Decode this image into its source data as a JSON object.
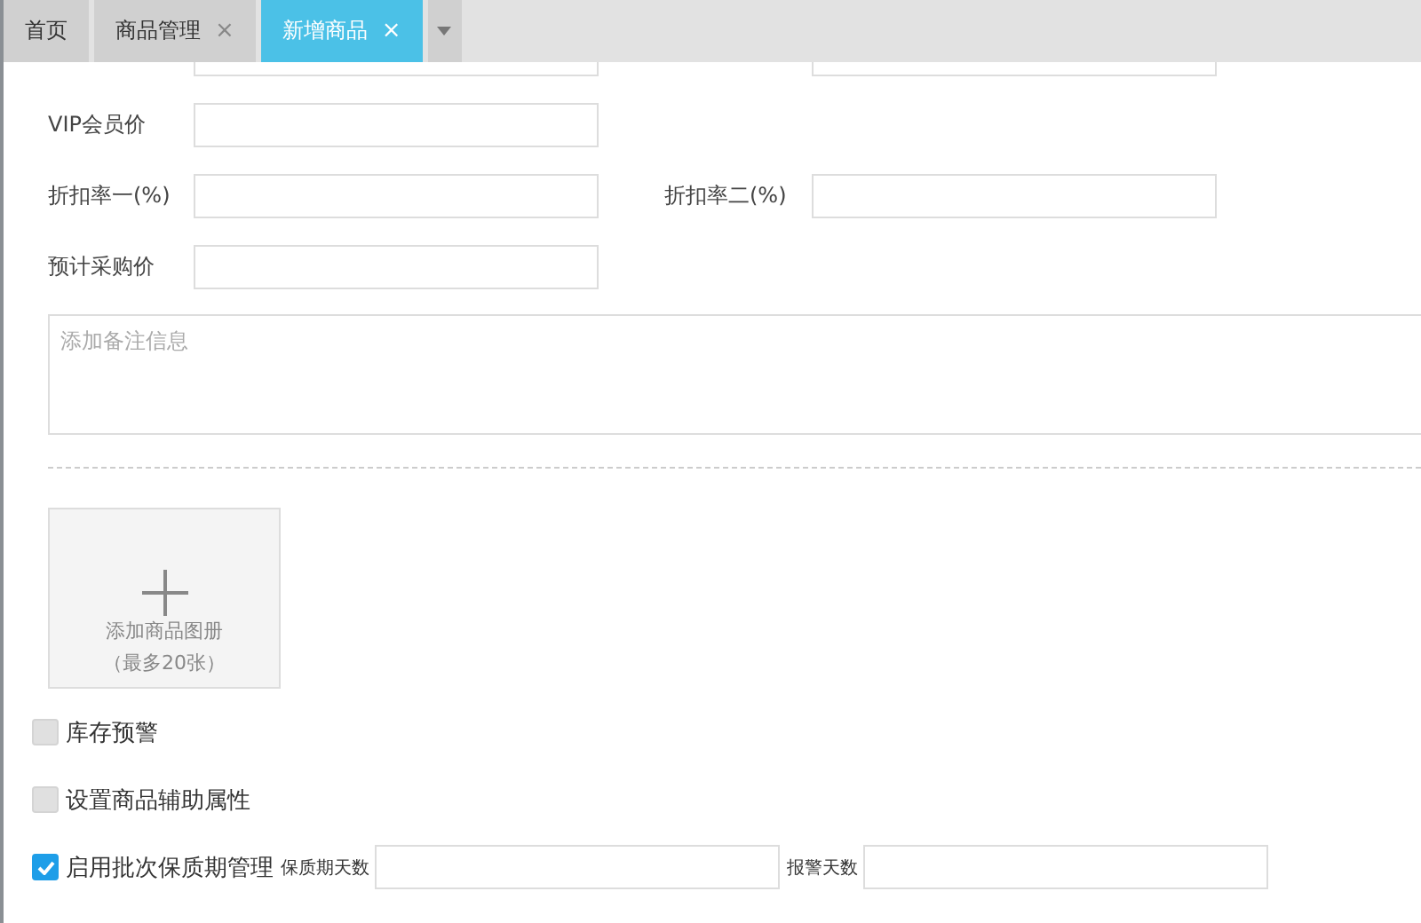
{
  "tabs": [
    {
      "label": "首页",
      "closable": false,
      "selected": false
    },
    {
      "label": "商品管理",
      "closable": true,
      "selected": false
    },
    {
      "label": "新增商品",
      "closable": true,
      "selected": true
    }
  ],
  "tab_close": "×",
  "form_rows": [
    {
      "label": "VIP会员价"
    },
    {
      "label": "折扣率一(%)",
      "second_label": "折扣率二(%)"
    },
    {
      "label": "预计采购价"
    }
  ],
  "remark": {
    "placeholder": "添加备注信息"
  },
  "album": {
    "title": "添加商品图册",
    "note": "（最多20张）"
  },
  "options": [
    {
      "label": "库存预警",
      "checked": false
    },
    {
      "label": "设置商品辅助属性",
      "checked": false
    },
    {
      "label": "启用批次保质期管理",
      "checked": true,
      "fields": [
        "保质期天数",
        "报警天数"
      ]
    }
  ]
}
